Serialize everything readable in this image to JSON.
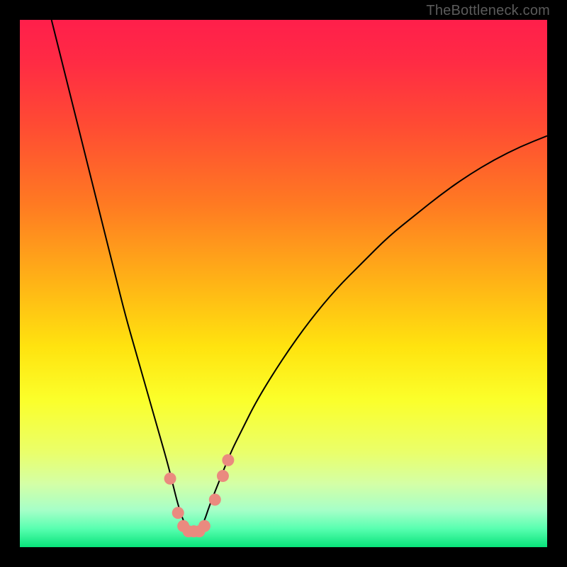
{
  "watermark": {
    "text": "TheBottleneck.com"
  },
  "colors": {
    "frame": "#000000",
    "curve": "#000000",
    "markers": "#ea8a7f",
    "gradient_stops": [
      {
        "offset": 0.0,
        "color": "#ff1f4b"
      },
      {
        "offset": 0.08,
        "color": "#ff2b44"
      },
      {
        "offset": 0.2,
        "color": "#ff4b33"
      },
      {
        "offset": 0.35,
        "color": "#ff7a22"
      },
      {
        "offset": 0.5,
        "color": "#ffb416"
      },
      {
        "offset": 0.62,
        "color": "#ffe30f"
      },
      {
        "offset": 0.72,
        "color": "#fbff2a"
      },
      {
        "offset": 0.82,
        "color": "#eaff6a"
      },
      {
        "offset": 0.88,
        "color": "#d4ffa6"
      },
      {
        "offset": 0.93,
        "color": "#a6ffc8"
      },
      {
        "offset": 0.965,
        "color": "#58ffb0"
      },
      {
        "offset": 1.0,
        "color": "#08e37a"
      }
    ]
  },
  "chart_data": {
    "type": "line",
    "title": "",
    "xlabel": "",
    "ylabel": "",
    "xlim": [
      0,
      100
    ],
    "ylim": [
      0,
      100
    ],
    "grid": false,
    "legend": false,
    "series": [
      {
        "name": "bottleneck-curve",
        "x": [
          6,
          8,
          10,
          12,
          14,
          16,
          18,
          20,
          22,
          24,
          26,
          28,
          29,
          30,
          31,
          32,
          33,
          34,
          35,
          36,
          38,
          40,
          42,
          45,
          50,
          55,
          60,
          65,
          70,
          75,
          80,
          85,
          90,
          95,
          100
        ],
        "y": [
          100,
          92,
          84,
          76,
          68,
          60,
          52,
          44,
          37,
          30,
          23,
          16,
          12,
          8,
          5,
          3,
          2.5,
          3,
          5,
          8,
          13,
          18,
          22,
          28,
          36,
          43,
          49,
          54,
          59,
          63,
          67,
          70.5,
          73.5,
          76,
          78
        ]
      }
    ],
    "markers": {
      "name": "highlighted-points",
      "x": [
        28.5,
        30,
        31,
        32,
        33,
        34,
        35,
        37,
        38.5,
        39.5
      ],
      "y": [
        13,
        6.5,
        4,
        3,
        3,
        3,
        4,
        9,
        13.5,
        16.5
      ]
    }
  }
}
